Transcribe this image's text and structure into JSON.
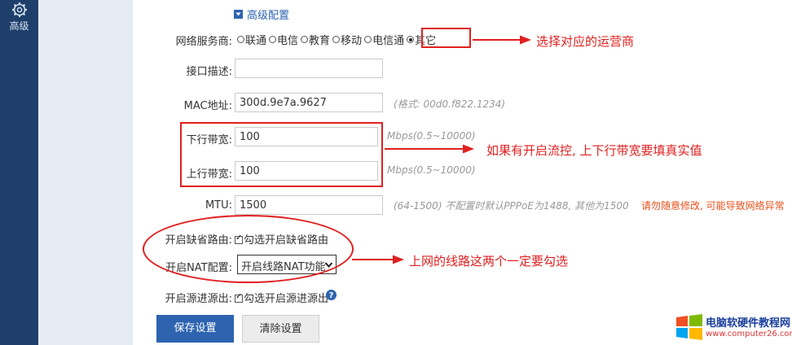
{
  "sidebar": {
    "item_label": "高级",
    "item_icon": "gear-icon"
  },
  "section": {
    "toggle_icon": "collapse-square-icon",
    "title": "高级配置"
  },
  "isp": {
    "label": "网络服务商:",
    "options": [
      {
        "label": "联通",
        "checked": false
      },
      {
        "label": "电信",
        "checked": false
      },
      {
        "label": "教育",
        "checked": false
      },
      {
        "label": "移动",
        "checked": false
      },
      {
        "label": "电信通",
        "checked": false
      },
      {
        "label": "其它",
        "checked": true
      }
    ]
  },
  "interface_desc": {
    "label": "接口描述:",
    "value": ""
  },
  "mac": {
    "label": "MAC地址:",
    "value": "300d.9e7a.9627",
    "hint": "(格式: 00d0.f822.1234)"
  },
  "downlink": {
    "label": "下行带宽:",
    "value": "100",
    "hint": "Mbps(0.5~10000)"
  },
  "uplink": {
    "label": "上行带宽:",
    "value": "100",
    "hint": "Mbps(0.5~10000)"
  },
  "mtu": {
    "label": "MTU:",
    "value": "1500",
    "hint": "(64-1500) 不配置时默认PPPoE为1488, 其他为1500",
    "warning": "请勿随意修改, 可能导致网络异常"
  },
  "default_route": {
    "label": "开启缺省路由:",
    "checkbox_label": "勾选开启缺省路由",
    "checked": true
  },
  "nat": {
    "label": "开启NAT配置:",
    "selected": "开启线路NAT功能"
  },
  "source_in_out": {
    "label": "开启源进源出:",
    "checkbox_label": "勾选开启源进源出",
    "checked": true,
    "help_icon": "question-circle-icon"
  },
  "buttons": {
    "save": "保存设置",
    "clear": "清除设置"
  },
  "annotations": {
    "isp": "选择对应的运营商",
    "bandwidth": "如果有开启流控, 上下行带宽要填真实值",
    "routing": "上网的线路这两个一定要勾选",
    "color": "#e02020"
  },
  "watermark": {
    "title": "电脑软硬件教程网",
    "url": "www.computer26.com",
    "logo": "windows-logo-icon"
  }
}
